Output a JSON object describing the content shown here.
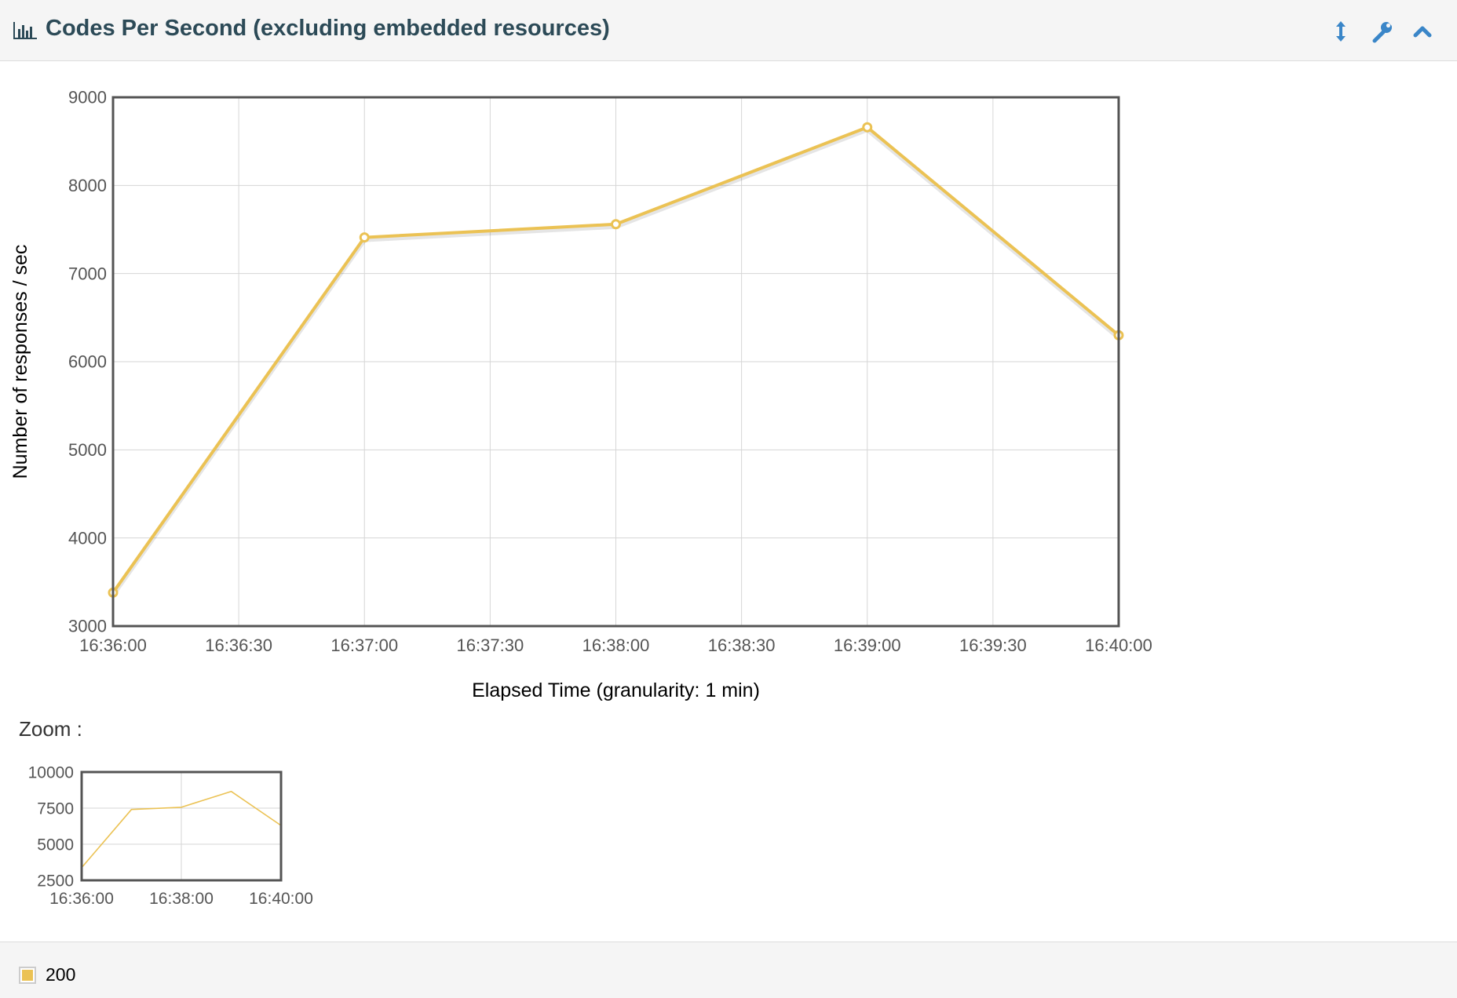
{
  "panel": {
    "title": "Codes Per Second (excluding embedded resources)",
    "icons": {
      "header": "bar-chart-icon",
      "resize": "vertical-arrows-icon",
      "settings": "wrench-icon",
      "collapse": "chevron-up-icon"
    },
    "accent_color": "#3a86c8"
  },
  "zoom": {
    "label": "Zoom :"
  },
  "legend": {
    "items": [
      {
        "label": "200",
        "color": "#ebc254"
      }
    ]
  },
  "chart_data": [
    {
      "type": "line",
      "x": [
        "16:36:00",
        "16:37:00",
        "16:38:00",
        "16:39:00",
        "16:40:00"
      ],
      "series": [
        {
          "name": "200",
          "values": [
            3380,
            7410,
            7560,
            8660,
            6300
          ],
          "color": "#ebc254"
        }
      ],
      "x_ticks": [
        "16:36:00",
        "16:36:30",
        "16:37:00",
        "16:37:30",
        "16:38:00",
        "16:38:30",
        "16:39:00",
        "16:39:30",
        "16:40:00"
      ],
      "y_ticks": [
        3000,
        4000,
        5000,
        6000,
        7000,
        8000,
        9000
      ],
      "xlabel": "Elapsed Time (granularity: 1 min)",
      "ylabel": "Number of responses / sec",
      "ylim": [
        3000,
        9000
      ],
      "grid": true,
      "markers": true
    },
    {
      "type": "line",
      "x": [
        "16:36:00",
        "16:37:00",
        "16:38:00",
        "16:39:00",
        "16:40:00"
      ],
      "series": [
        {
          "name": "200",
          "values": [
            3380,
            7410,
            7560,
            8660,
            6300
          ],
          "color": "#ebc254"
        }
      ],
      "x_ticks": [
        "16:36:00",
        "16:38:00",
        "16:40:00"
      ],
      "y_ticks": [
        2500,
        5000,
        7500,
        10000
      ],
      "ylim": [
        2500,
        10000
      ],
      "grid": true,
      "markers": false
    }
  ]
}
